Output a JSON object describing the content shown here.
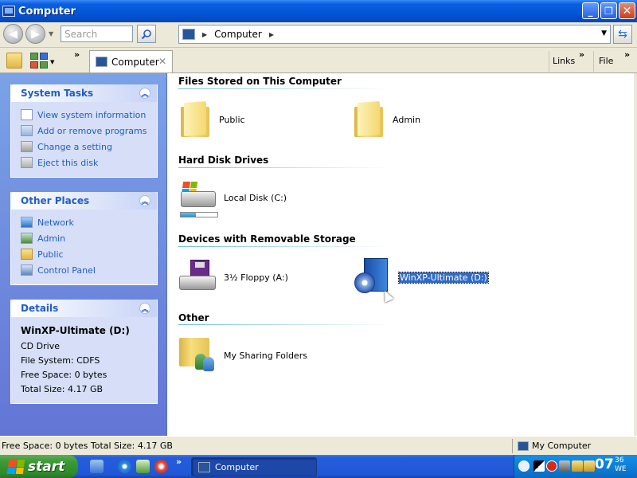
{
  "window": {
    "title": "Computer",
    "minimize": "_",
    "restore": "❐",
    "close": "✕"
  },
  "nav": {
    "back": "◀",
    "forward": "▶",
    "history_dd": "▼",
    "search_placeholder": "Search",
    "address_crumb": "Computer",
    "address_sep": "▶",
    "address_dd": "▼",
    "refresh": "⇆"
  },
  "toolbar": {
    "chevron": "»",
    "grid_dd": "▼",
    "tab_label": "Computer",
    "tab_close": "✕",
    "links": "Links",
    "file": "File"
  },
  "tasks": {
    "system_tasks": {
      "title": "System Tasks",
      "collapse": "︽",
      "items": [
        {
          "label": "View system information",
          "icon": "check-icon"
        },
        {
          "label": "Add or remove programs",
          "icon": "add-remove-icon"
        },
        {
          "label": "Change a setting",
          "icon": "settings-icon"
        },
        {
          "label": "Eject this disk",
          "icon": "eject-icon"
        }
      ]
    },
    "other_places": {
      "title": "Other Places",
      "collapse": "︽",
      "items": [
        {
          "label": "Network",
          "icon": "network-icon"
        },
        {
          "label": "Admin",
          "icon": "user-folder-icon"
        },
        {
          "label": "Public",
          "icon": "folder-icon"
        },
        {
          "label": "Control Panel",
          "icon": "control-panel-icon"
        }
      ]
    },
    "details": {
      "title": "Details",
      "collapse": "︽",
      "name": "WinXP-Ultimate (D:)",
      "type": "CD Drive",
      "file_system": "File System: CDFS",
      "free_space": "Free Space: 0 bytes",
      "total_size": "Total Size: 4.17 GB"
    }
  },
  "content": {
    "sections": [
      {
        "title": "Files Stored on This Computer"
      },
      {
        "title": "Hard Disk Drives"
      },
      {
        "title": "Devices with Removable Storage"
      },
      {
        "title": "Other"
      }
    ],
    "items": {
      "public": "Public",
      "admin": "Admin",
      "local_disk": "Local Disk (C:)",
      "local_disk_usage": 0.42,
      "floppy": "3½ Floppy (A:)",
      "cd": "WinXP-Ultimate (D:)",
      "sharing": "My Sharing Folders"
    }
  },
  "status": {
    "left": "Free Space: 0 bytes Total Size: 4.17 GB",
    "right": "My Computer"
  },
  "taskbar": {
    "start": "start",
    "chevron": "»",
    "task_button": "Computer",
    "clock": "07",
    "clock_sup": "36",
    "clock_sub": "WE"
  }
}
